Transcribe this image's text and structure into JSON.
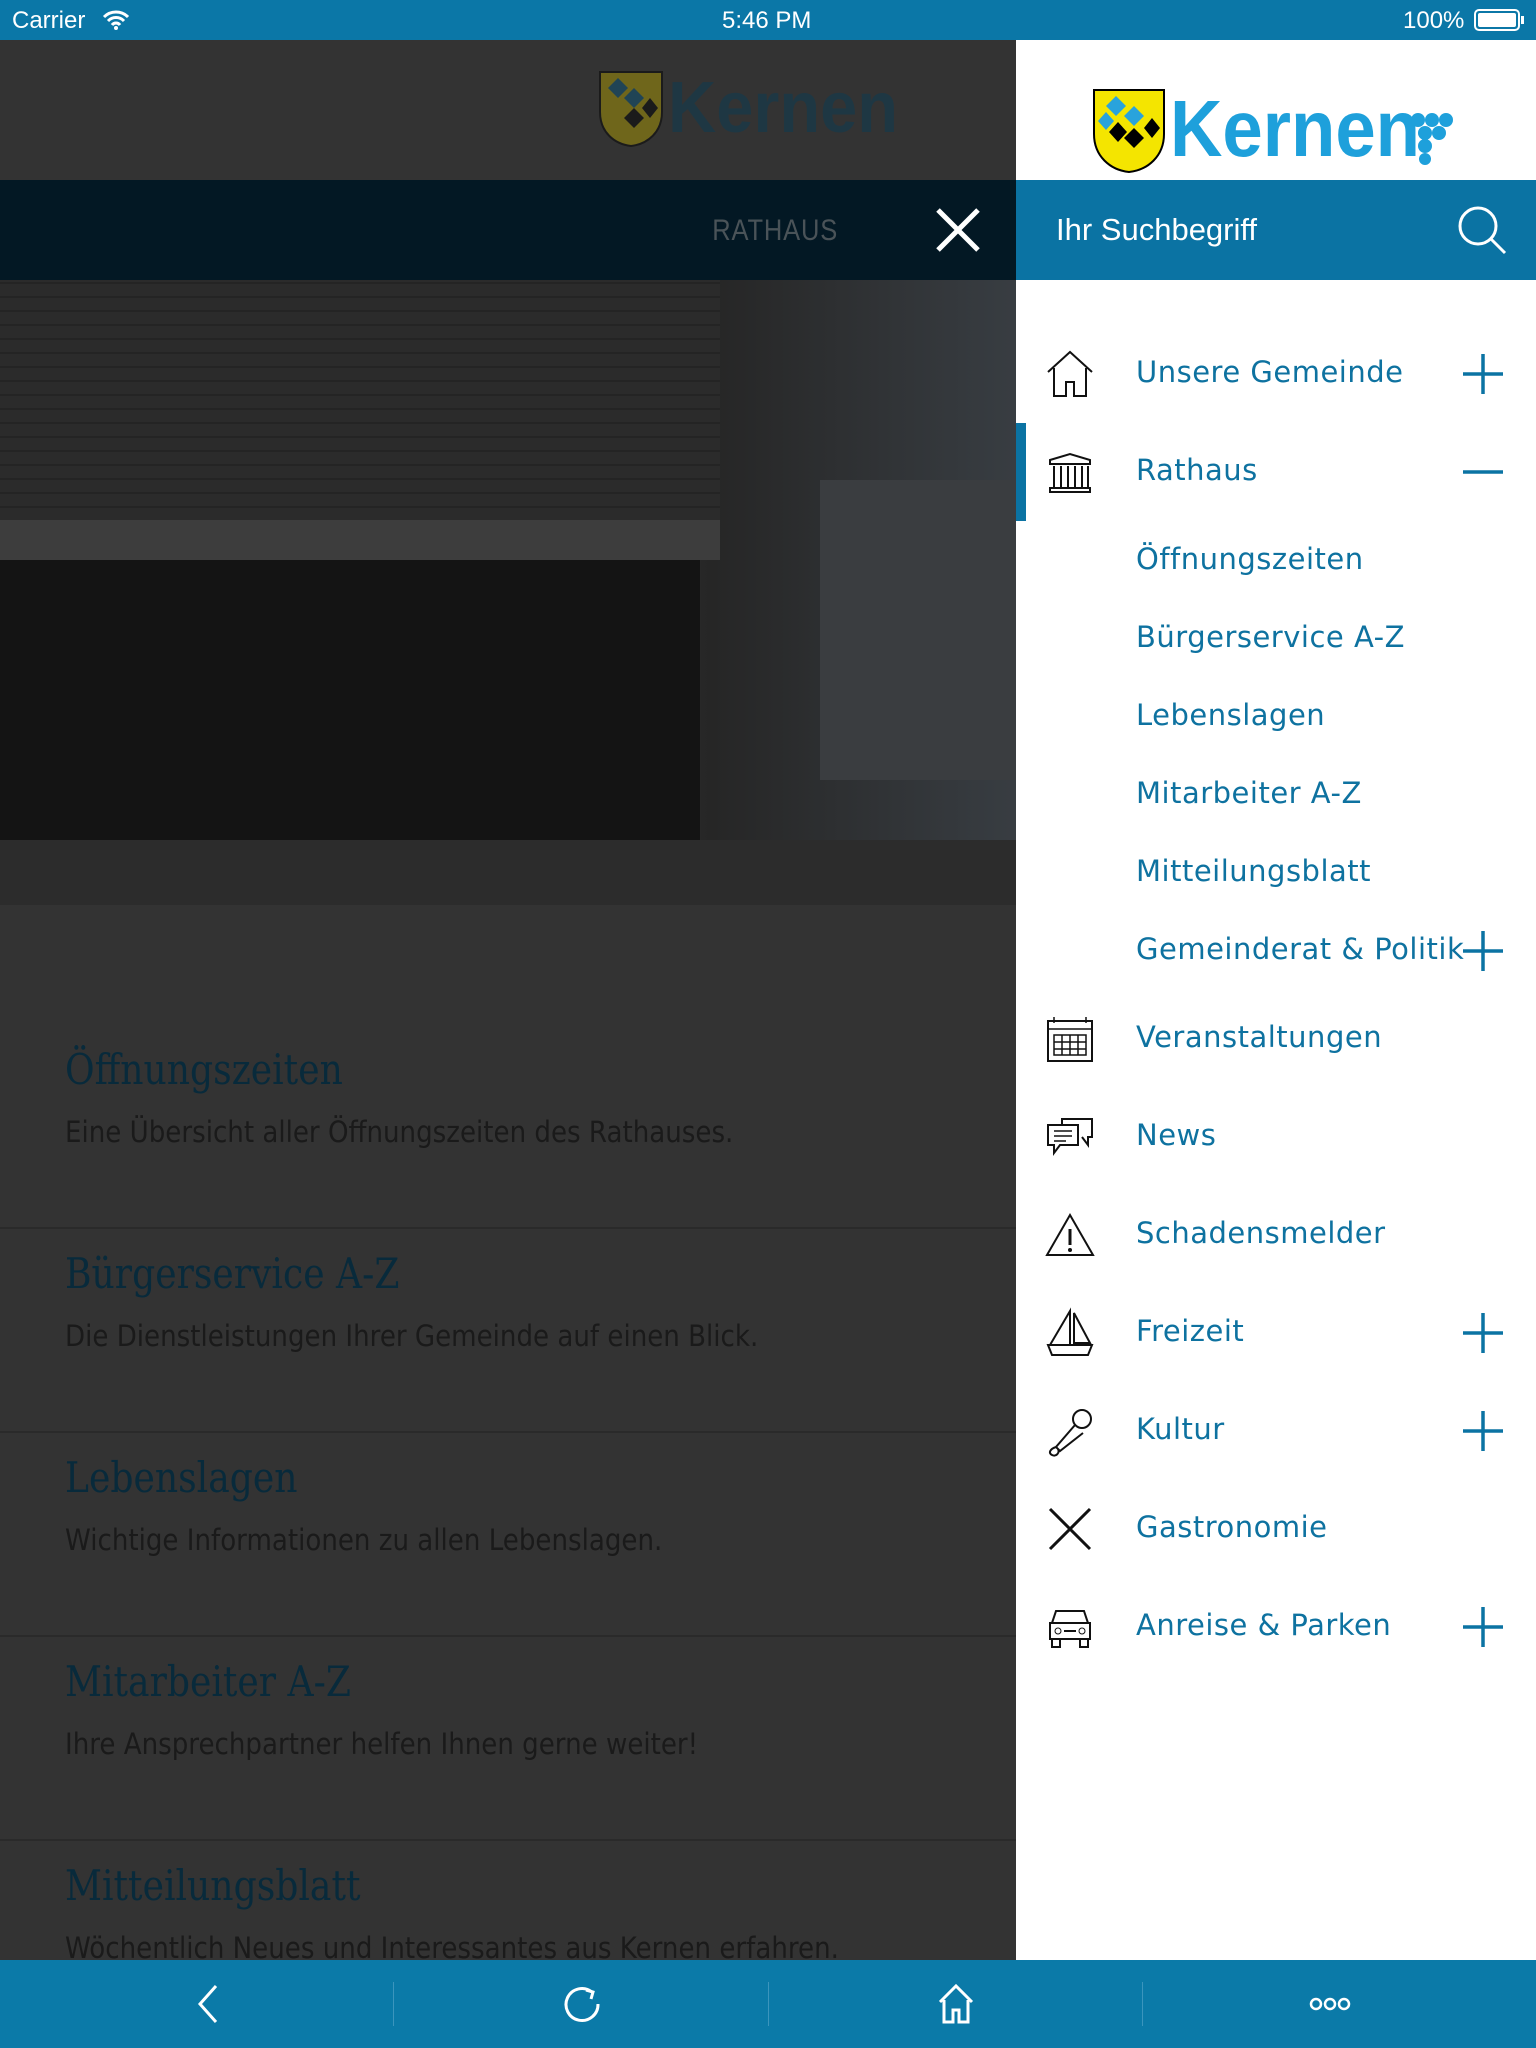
{
  "status_bar": {
    "carrier": "Carrier",
    "time": "5:46 PM",
    "battery": "100%"
  },
  "colors": {
    "brand_blue": "#0b73a3",
    "menu_text": "#0e72a0",
    "overlay": "#333333"
  },
  "logo": {
    "text": "Kernen"
  },
  "header": {
    "section_title": "RATHAUS",
    "close_icon": "close-icon"
  },
  "content": {
    "items": [
      {
        "title": "Öffnungszeiten",
        "description": "Eine Übersicht aller Öffnungszeiten des Rathauses."
      },
      {
        "title": "Bürgerservice A-Z",
        "description": "Die Dienstleistungen Ihrer Gemeinde auf einen Blick."
      },
      {
        "title": "Lebenslagen",
        "description": "Wichtige Informationen zu allen Lebenslagen."
      },
      {
        "title": "Mitarbeiter A-Z",
        "description": "Ihre Ansprechpartner helfen Ihnen gerne weiter!"
      },
      {
        "title": "Mitteilungsblatt",
        "description": "Wöchentlich Neues und Interessantes aus Kernen erfahren."
      }
    ]
  },
  "menu": {
    "search_placeholder": "Ihr Suchbegriff",
    "items": [
      {
        "label": "Unsere Gemeinde",
        "icon": "house-icon",
        "toggle": "plus"
      },
      {
        "label": "Rathaus",
        "icon": "town-hall-icon",
        "toggle": "minus",
        "active": true
      },
      {
        "label": "Öffnungszeiten",
        "sub": true
      },
      {
        "label": "Bürgerservice A-Z",
        "sub": true
      },
      {
        "label": "Lebenslagen",
        "sub": true
      },
      {
        "label": "Mitarbeiter A-Z",
        "sub": true
      },
      {
        "label": "Mitteilungsblatt",
        "sub": true
      },
      {
        "label": "Gemeinderat & Politik",
        "sub": true,
        "toggle": "plus"
      },
      {
        "label": "Veranstaltungen",
        "icon": "calendar-icon"
      },
      {
        "label": "News",
        "icon": "chat-bubbles-icon"
      },
      {
        "label": "Schadensmelder",
        "icon": "warning-icon"
      },
      {
        "label": "Freizeit",
        "icon": "sailboat-icon",
        "toggle": "plus"
      },
      {
        "label": "Kultur",
        "icon": "microphone-icon",
        "toggle": "plus"
      },
      {
        "label": "Gastronomie",
        "icon": "fork-knife-icon"
      },
      {
        "label": "Anreise & Parken",
        "icon": "car-icon",
        "toggle": "plus"
      }
    ]
  },
  "bottom_bar": {
    "items": [
      "back-icon",
      "reload-icon",
      "home-icon",
      "more-icon"
    ]
  }
}
